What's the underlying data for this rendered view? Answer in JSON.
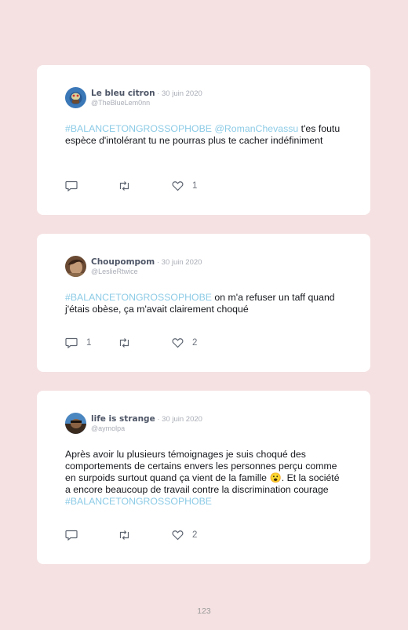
{
  "tweets": [
    {
      "name": "Le bleu citron",
      "separator": " · ",
      "date": "30 juin 2020",
      "handle": "@TheBlueLem0nn",
      "hashtag": "#BALANCETONGROSSOPHOBE",
      "mention": "@RomanChevassu",
      "text": " t'es foutu espèce d'intolérant tu ne pourras plus te cacher indéfiniment",
      "replies": "",
      "retweets": "",
      "likes": "1"
    },
    {
      "name": "Choupompom",
      "separator": " · ",
      "date": "30 juin 2020",
      "handle": "@LeslieRtwice",
      "hashtag": "#BALANCETONGROSSOPHOBE",
      "text": " on m'a refuser un taff quand j'étais obèse, ça m'avait clairement choqué",
      "replies": "1",
      "retweets": "",
      "likes": "2"
    },
    {
      "name": "life is strange",
      "separator": " · ",
      "date": "30 juin 2020",
      "handle": "@aymolpa",
      "text": "Après avoir lu plusieurs témoignages je suis choqué des comportements de certains envers les personnes perçu comme en surpoids surtout quand ça vient de la famille 😮. Et la société a encore beaucoup de travail contre la discrimination courage ",
      "hashtag": "#BALANCETONGROSSOPHOBE",
      "replies": "",
      "retweets": "",
      "likes": "2"
    }
  ],
  "page_number": "123",
  "colors": {
    "background": "#f5e1e2",
    "card": "#ffffff",
    "hashtag": "#8ccbe6",
    "name": "#4d5566",
    "meta": "#a9adb6"
  },
  "icons": [
    "reply-icon",
    "retweet-icon",
    "like-icon"
  ]
}
